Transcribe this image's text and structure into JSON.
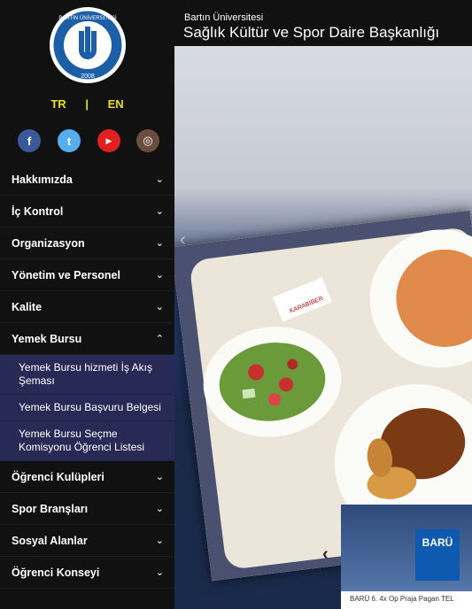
{
  "header": {
    "subtitle": "Bartın Üniversitesi",
    "title": "Sağlık Kültür ve Spor Daire Başkanlığı"
  },
  "logo": {
    "text_top": "BARTIN ÜNİVERSİTESİ",
    "year": "2008"
  },
  "lang": {
    "tr": "TR",
    "sep": "|",
    "en": "EN"
  },
  "social": [
    {
      "icon": "facebook-icon",
      "glyph": "f",
      "color": "#3b5998"
    },
    {
      "icon": "twitter-icon",
      "glyph": "t",
      "color": "#55acee"
    },
    {
      "icon": "youtube-icon",
      "glyph": "▶",
      "color": "#e02020"
    },
    {
      "icon": "instagram-icon",
      "glyph": "◎",
      "color": "#6b4d3e"
    }
  ],
  "menu": [
    {
      "label": "Hakkımızda",
      "chev": "⌄"
    },
    {
      "label": "İç Kontrol",
      "chev": "⌄"
    },
    {
      "label": "Organizasyon",
      "chev": "⌄"
    },
    {
      "label": "Yönetim ve Personel",
      "chev": "⌄"
    },
    {
      "label": "Kalite",
      "chev": "⌄"
    },
    {
      "label": "Yemek Bursu",
      "chev": "⌃"
    }
  ],
  "submenu": [
    "Yemek Bursu hizmeti İş Akış Şeması",
    "Yemek Bursu Başvuru Belgesi",
    "Yemek Bursu Seçme Komisyonu Öğrenci Listesi"
  ],
  "menu_after": [
    {
      "label": "Öğrenci Kulüpleri",
      "chev": "⌄"
    },
    {
      "label": "Spor Branşları",
      "chev": "⌄"
    },
    {
      "label": "Sosyal Alanlar",
      "chev": "⌄"
    },
    {
      "label": "Öğrenci Konseyi",
      "chev": "⌄"
    }
  ],
  "slider": {
    "prev": "‹"
  },
  "tray": {
    "label": "KARABİBER"
  },
  "news": {
    "banner": "BARÜ",
    "caption": "BARÜ 6. 4x Op Praja Pagan TEL",
    "prev": "‹"
  },
  "colors": {
    "submenu_bg": "#272a55",
    "lang": "#e3e01e"
  }
}
